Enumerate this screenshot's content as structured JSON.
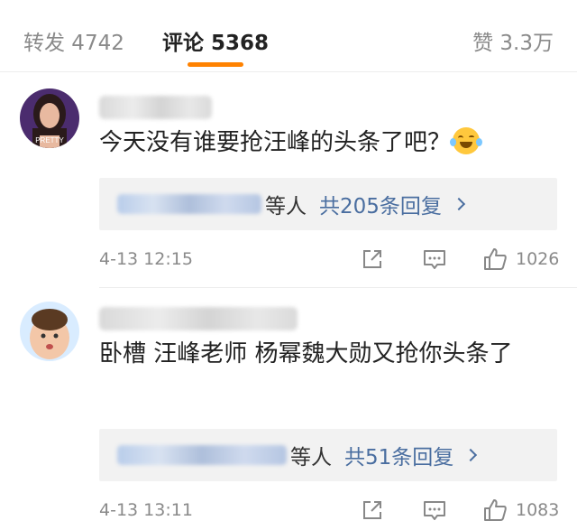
{
  "tabs": {
    "reposts": "转发 4742",
    "comments": "评论 5368",
    "likes": "赞 3.3万"
  },
  "accent_color": "#ff8200",
  "link_color": "#4a6ea0",
  "comments": [
    {
      "text": "今天没有谁要抢汪峰的头条了吧？",
      "emoji": "laughing-crying-emoji",
      "reply_suffix": "等人",
      "reply_link": "共205条回复",
      "time": "4-13 12:15",
      "likes": "1026",
      "avatar_text": "PRETTY"
    },
    {
      "text": "卧槽 汪峰老师 杨幂魏大勋又抢你头条了",
      "reply_suffix": "等人",
      "reply_link": "共51条回复",
      "time": "4-13 13:11",
      "likes": "1083"
    }
  ]
}
